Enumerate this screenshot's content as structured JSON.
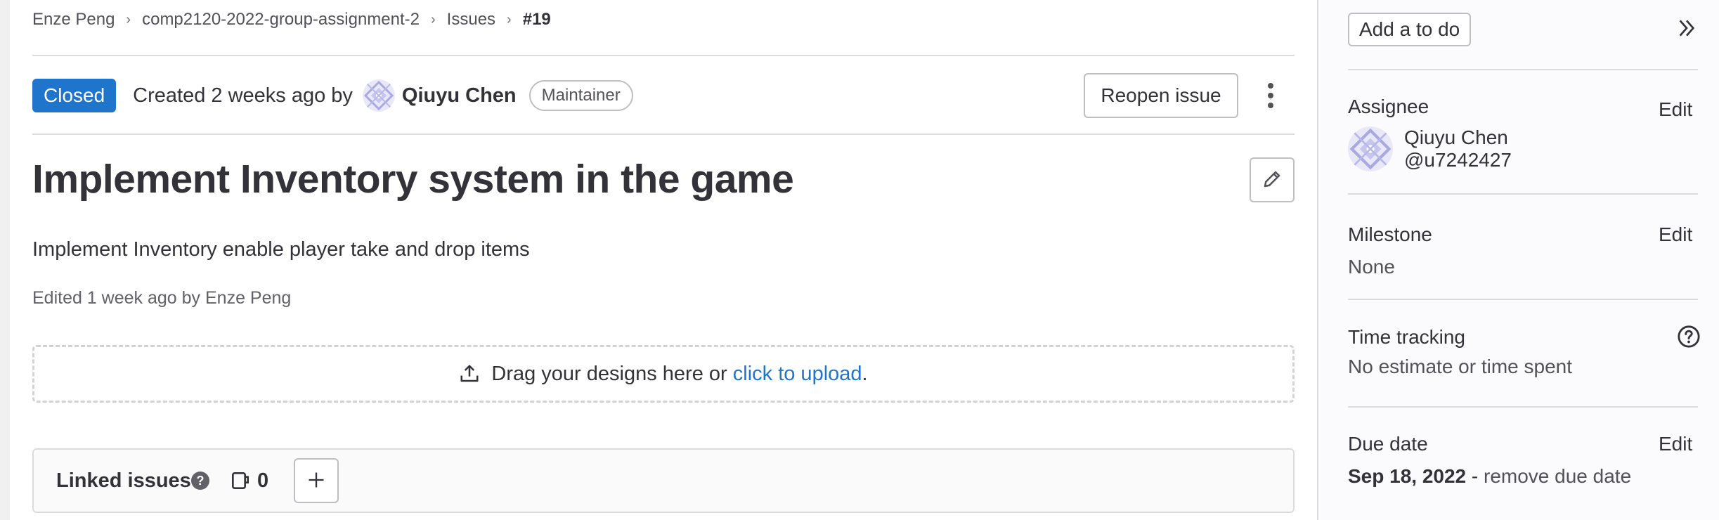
{
  "breadcrumb": {
    "items": [
      "Enze Peng",
      "comp2120-2022-group-assignment-2",
      "Issues"
    ],
    "current": "#19"
  },
  "issue": {
    "status": "Closed",
    "created_text": "Created 2 weeks ago by",
    "author": "Qiuyu Chen",
    "author_role": "Maintainer",
    "reopen_label": "Reopen issue",
    "title": "Implement Inventory system in the game",
    "description": "Implement Inventory enable player take and drop items",
    "edited_text": "Edited 1 week ago by Enze Peng"
  },
  "design_upload": {
    "text": "Drag your designs here or",
    "link": "click to upload",
    "suffix": "."
  },
  "linked_issues": {
    "title": "Linked issues",
    "help": "?",
    "count": "0"
  },
  "sidebar": {
    "todo_label": "Add a to do",
    "assignee": {
      "label": "Assignee",
      "edit": "Edit",
      "name": "Qiuyu Chen",
      "username": "@u7242427"
    },
    "milestone": {
      "label": "Milestone",
      "edit": "Edit",
      "value": "None"
    },
    "time_tracking": {
      "label": "Time tracking",
      "value": "No estimate or time spent"
    },
    "due_date": {
      "label": "Due date",
      "edit": "Edit",
      "date": "Sep 18, 2022",
      "dash": " - ",
      "remove": "remove due date"
    }
  },
  "colors": {
    "status_closed": "#1f75cb",
    "link": "#1f75cb"
  }
}
